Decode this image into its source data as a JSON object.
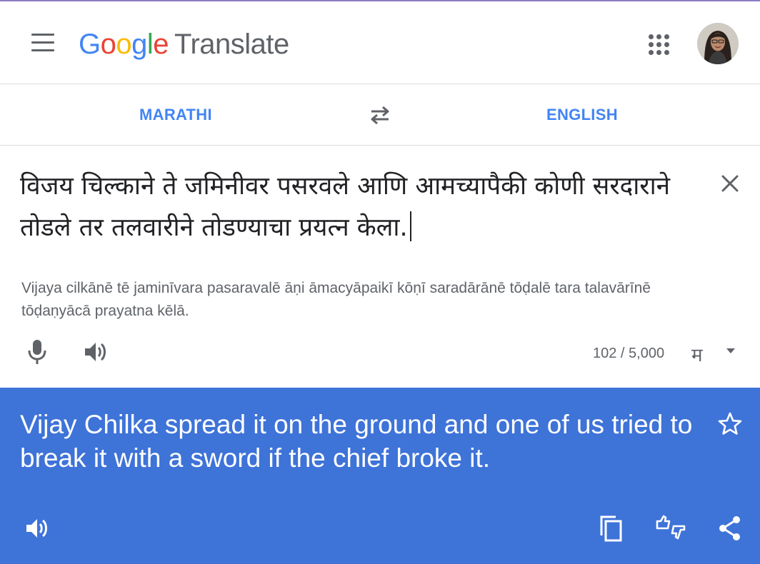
{
  "header": {
    "logo_letters": [
      "G",
      "o",
      "o",
      "g",
      "l",
      "e"
    ],
    "product_name": "Translate",
    "menu_icon": "hamburger-menu-icon",
    "apps_icon": "apps-grid-icon",
    "avatar": "account-avatar"
  },
  "languages": {
    "source": "MARATHI",
    "target": "ENGLISH",
    "swap_icon": "swap-arrows-icon"
  },
  "source": {
    "text": "विजय चिल्काने ते जमिनीवर पसरवले आणि आमच्यापैकी कोणी सरदाराने तोडले तर तलवारीने तोडण्याचा प्रयत्न केला.",
    "transliteration": "Vijaya cilkānē tē jaminīvara pasaravalē āṇi āmacyāpaikī kōṇī saradārānē tōḍalē tara talavārīnē tōḍaṇyācā prayatna kēlā.",
    "char_count": "102 / 5,000",
    "input_method": "म",
    "clear_icon": "close-icon",
    "mic_icon": "microphone-icon",
    "speaker_icon": "speaker-icon"
  },
  "result": {
    "text": "Vijay Chilka spread it on the ground and one of us tried to break it with a sword if the chief broke it.",
    "star_icon": "star-outline-icon",
    "speaker_icon": "speaker-icon",
    "copy_icon": "copy-icon",
    "feedback_icon": "thumbs-feedback-icon",
    "share_icon": "share-icon"
  },
  "colors": {
    "accent_blue": "#4285f4",
    "result_bg": "#3e73d8",
    "icon_gray": "#5f6368"
  }
}
